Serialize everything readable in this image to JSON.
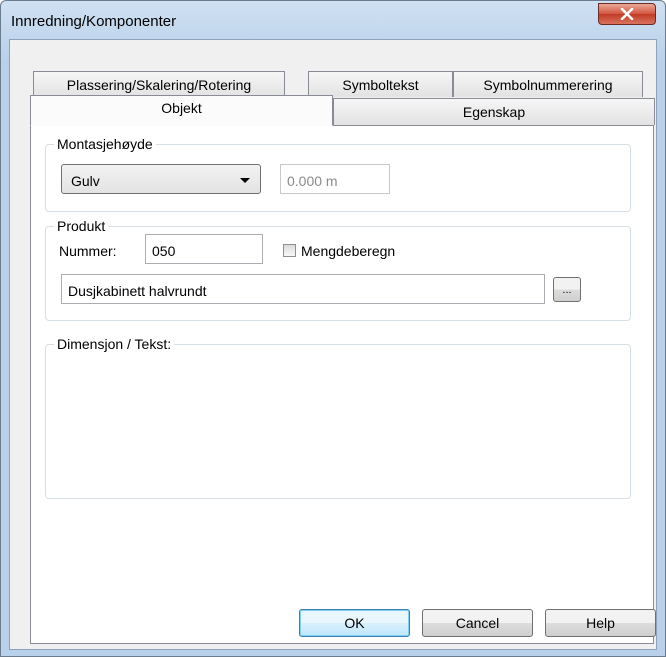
{
  "window": {
    "title": "Innredning/Komponenter"
  },
  "tabs": {
    "row_back": [
      "Plassering/Skalering/Rotering",
      "Symboltekst",
      "Symbolnummerering"
    ],
    "row_front": [
      "Objekt",
      "Egenskap"
    ],
    "active": "Objekt"
  },
  "montasje": {
    "label": "Montasjehøyde",
    "select_value": "Gulv",
    "height_value": "0.000 m"
  },
  "produkt": {
    "label": "Produkt",
    "nummer_label": "Nummer:",
    "nummer_value": "050",
    "mengde_label": "Mengdeberegn",
    "mengde_checked": false,
    "description_value": "Dusjkabinett halvrundt",
    "browse_label": "..."
  },
  "dimensjon": {
    "label": "Dimensjon / Tekst:"
  },
  "buttons": {
    "ok": "OK",
    "cancel": "Cancel",
    "help": "Help"
  },
  "colors": {
    "close_button": "#c13b25",
    "title_bar": "#b9d1ea",
    "default_button_border": "#3c7fb1"
  }
}
